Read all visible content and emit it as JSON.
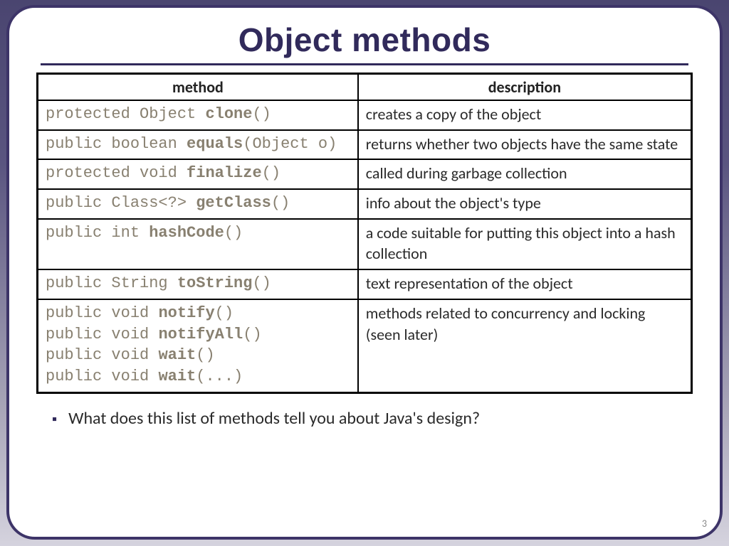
{
  "title": "Object methods",
  "table": {
    "headers": {
      "method": "method",
      "description": "description"
    },
    "rows": [
      {
        "signatures": [
          {
            "pre": "protected Object ",
            "name": "clone",
            "post": "()"
          }
        ],
        "description": "creates a copy of the object"
      },
      {
        "signatures": [
          {
            "pre": "public boolean ",
            "name": "equals",
            "post": "(Object o)"
          }
        ],
        "description": "returns whether two objects have the same state"
      },
      {
        "signatures": [
          {
            "pre": "protected void ",
            "name": "finalize",
            "post": "()"
          }
        ],
        "description": "called during garbage collection"
      },
      {
        "signatures": [
          {
            "pre": "public Class<?> ",
            "name": "getClass",
            "post": "()"
          }
        ],
        "description": "info about the object's type"
      },
      {
        "signatures": [
          {
            "pre": "public int ",
            "name": "hashCode",
            "post": "()"
          }
        ],
        "description": "a code suitable for putting this object into a hash collection"
      },
      {
        "signatures": [
          {
            "pre": "public String ",
            "name": "toString",
            "post": "()"
          }
        ],
        "description": "text representation of the object"
      },
      {
        "signatures": [
          {
            "pre": "public void ",
            "name": "notify",
            "post": "()"
          },
          {
            "pre": "public void ",
            "name": "notifyAll",
            "post": "()"
          },
          {
            "pre": "public void ",
            "name": "wait",
            "post": "()"
          },
          {
            "pre": "public void ",
            "name": "wait",
            "post": "(...)"
          }
        ],
        "description": "methods related to concurrency and locking  (seen later)"
      }
    ]
  },
  "question": "What does this list of methods tell you about Java's design?",
  "page_number": "3"
}
